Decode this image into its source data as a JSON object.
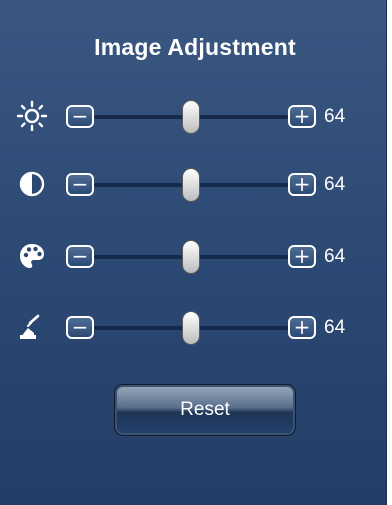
{
  "panel": {
    "title": "Image Adjustment"
  },
  "controls": [
    {
      "name": "brightness",
      "icon": "brightness-icon",
      "minus": "−",
      "plus": "+",
      "value": 64,
      "max": 128
    },
    {
      "name": "contrast",
      "icon": "contrast-icon",
      "minus": "−",
      "plus": "+",
      "value": 64,
      "max": 128
    },
    {
      "name": "saturation",
      "icon": "palette-icon",
      "minus": "−",
      "plus": "+",
      "value": 64,
      "max": 128
    },
    {
      "name": "sharpness",
      "icon": "sharpness-icon",
      "minus": "−",
      "plus": "+",
      "value": 64,
      "max": 128
    }
  ],
  "reset_label": "Reset",
  "colors": {
    "panel": "#2b4873",
    "track": "#152a4a",
    "text": "#ffffff"
  }
}
